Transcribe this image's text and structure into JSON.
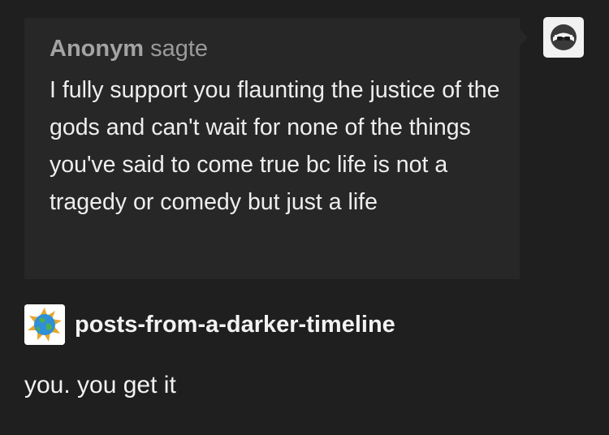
{
  "ask": {
    "asker_name": "Anonym",
    "asker_verb": "sagte",
    "question": "I fully support you flaunting the justice of the gods and can't wait for none of the things you've said to come true bc life is not a tragedy or comedy but just a life"
  },
  "anon_avatar": {
    "icon": "sunglasses-ghost-icon"
  },
  "answer": {
    "blog_name": "posts-from-a-darker-timeline",
    "blog_avatar_icon": "earth-globe-icon",
    "text": "you. you get it"
  },
  "colors": {
    "background": "#1f1f1f",
    "bubble": "#272727",
    "text": "#eeeeee",
    "muted": "#9a9a9a"
  }
}
